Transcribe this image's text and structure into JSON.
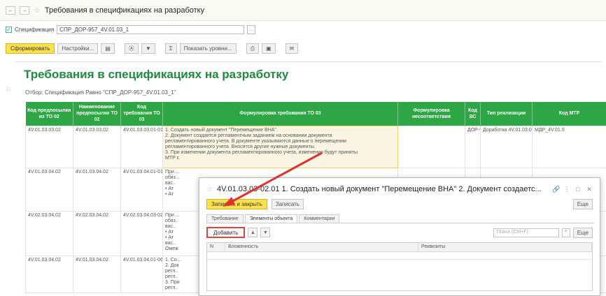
{
  "window": {
    "title": "Требования в спецификациях на разработку",
    "back": "←",
    "forward": "→",
    "star": "☆"
  },
  "filter": {
    "label": "Спецификация",
    "value": "СПР_ДОР-957_4V.01.03_1"
  },
  "toolbar": {
    "generate": "Сформировать",
    "settings": "Настройки...",
    "items": [
      "▤",
      "Ⓐ",
      "▼",
      "Σ",
      "Показать уровни...",
      "⎙",
      "▣",
      "✉"
    ]
  },
  "report": {
    "title": "Требования в спецификациях на разработку",
    "filter_text": "Отбор:   Спецификация Равно \"СПР_ДОР-957_4V.01.03_1\"",
    "columns": [
      "Код предпосылки из ТО 02",
      "Наименование предпосылки ТО 02",
      "Код требования ТО 03",
      "Формулировка требования ТО 03",
      "Формулировка несоответствия",
      "Код ВС",
      "Тип реализации",
      "Код МТР"
    ],
    "rows": [
      {
        "cells": [
          "4V.01.03.03.02",
          "4V.01.03.03.02",
          "4V.01.03.03.01-01",
          "",
          "",
          "ДОР-957",
          "Доработка 4V.01.03.03.01-01",
          "МДР_4V.01.0"
        ],
        "lines": [
          "1. Создать новый документ \"Перемещение ВНА\".",
          "2. Документ создается регламентным заданием на основании документа",
          "регламентированного учета. В документе указываются данные о перемещении",
          "регламентированного учета. Вносятся другие нужные документы.",
          "3. При изменении документа регламентированного учета, изменения будут приняты",
          "МТР с"
        ]
      },
      {
        "cells": [
          "4V.01.03.04.02",
          "4V.01.03.04.02",
          "4V.01.03.04.01-01",
          "",
          "",
          "",
          "",
          ""
        ],
        "lines": [
          "При ...",
          "обяз...",
          "вас..",
          "• Ат",
          "• Ат"
        ]
      },
      {
        "cells": [
          "4V.02.03.04.02",
          "4V.02.03.04.02",
          "4V.02.03.04.03-02",
          "",
          "",
          "",
          "",
          ""
        ],
        "lines": [
          "При ...",
          "обяз..",
          "вас..",
          "• Ат",
          "• Ат",
          "вас..",
          "Омеж"
        ]
      },
      {
        "cells": [
          "4V.01.03.04.02",
          "4V.01.03.04.02",
          "4V.01.03.04.01-06",
          "",
          "",
          "",
          "",
          ""
        ],
        "lines": [
          "1. Со...",
          "2. Док",
          "регл..",
          "регл..",
          "3. При",
          "регл.."
        ]
      }
    ]
  },
  "dialog": {
    "title": "4V.01.03.03-02.01 1. Создать новый документ \"Перемещение ВНА\" 2. Документ создаетс...",
    "save_close": "Записать и закрыть",
    "save": "Записать",
    "more": "Еще",
    "tabs": [
      "Требование",
      "Элементы объекта",
      "Комментарии"
    ],
    "add": "Добавить",
    "search_placeholder": "Поиск (Ctrl+F)",
    "columns": [
      "N",
      "Вложенность",
      "Реквизиты"
    ]
  },
  "colors": {
    "green": "#2ea645",
    "title_green": "#1f8b3d",
    "yellow": "#fbe14b",
    "red_arrow": "#e03232"
  }
}
